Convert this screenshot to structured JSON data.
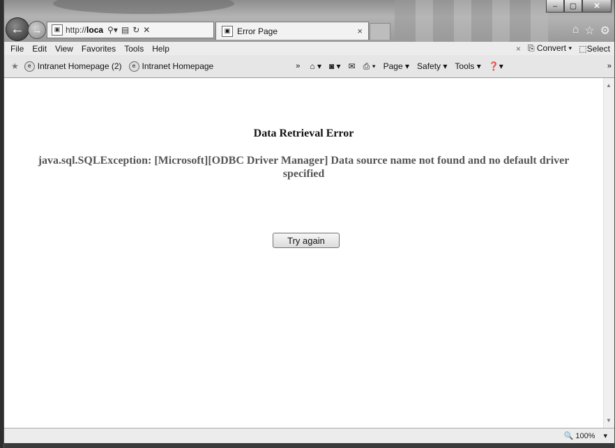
{
  "titlebar": {
    "address_prefix": "http://",
    "address_host": "loca",
    "tab_title": "Error Page",
    "tab_close": "×",
    "back_icon": "back-arrow-icon",
    "forward_icon": "forward-arrow-icon",
    "minimize": "–",
    "maximize": "▢",
    "close": "✕",
    "home_icon": "⌂",
    "favorites_icon": "☆",
    "settings_icon": "⚙"
  },
  "menu": {
    "file": "File",
    "edit": "Edit",
    "view": "View",
    "favorites": "Favorites",
    "tools": "Tools",
    "help": "Help",
    "close_x": "×",
    "convert": "Convert",
    "select": "Select"
  },
  "favorites_bar": {
    "items": [
      "Intranet Homepage (2)",
      "Intranet Homepage"
    ],
    "overflow": "»",
    "page": "Page",
    "safety": "Safety",
    "tools": "Tools",
    "overflow_right": "»"
  },
  "content": {
    "heading": "Data Retrieval Error",
    "message": "java.sql.SQLException: [Microsoft][ODBC Driver Manager] Data source name not found and no default driver specified",
    "button_label": "Try again"
  },
  "status": {
    "zoom_icon": "🔍",
    "zoom": "100%",
    "zoom_dropdown": "▾"
  },
  "colors": {
    "content_bg": "#ffffff",
    "heading": "#111111",
    "message": "#555555"
  }
}
